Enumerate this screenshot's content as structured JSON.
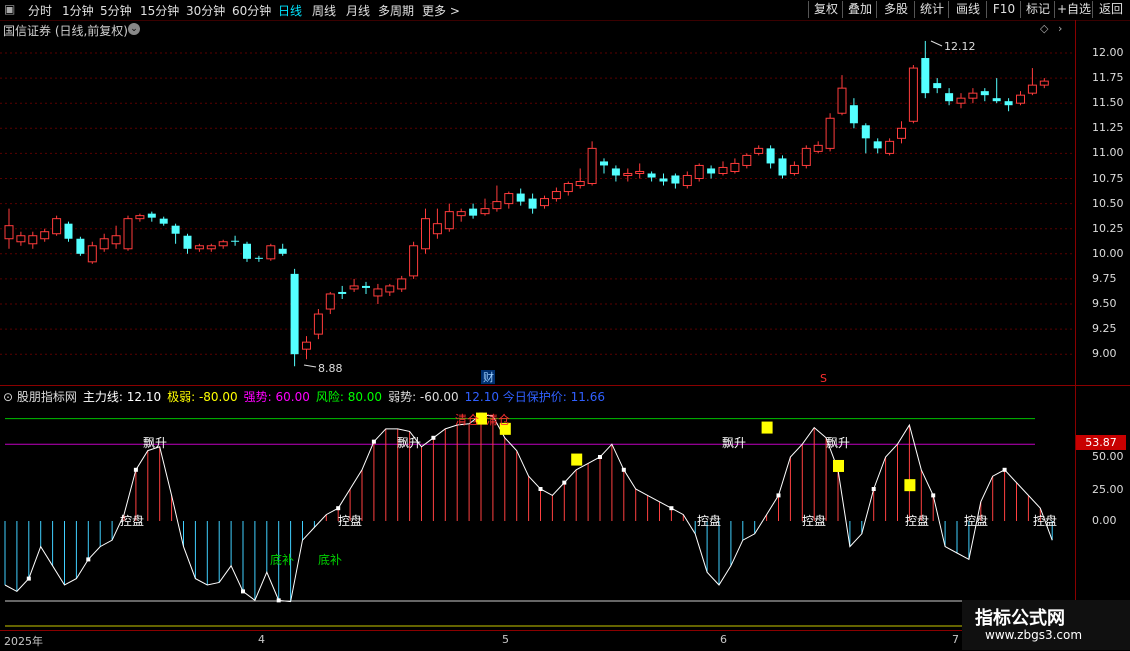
{
  "toolbar": {
    "periods": [
      "分时",
      "1分钟",
      "5分钟",
      "15分钟",
      "30分钟",
      "60分钟",
      "日线",
      "周线",
      "月线",
      "多周期",
      "更多 >"
    ],
    "active_period": "日线",
    "buttons": [
      "复权",
      "叠加",
      "多股",
      "统计",
      "画线",
      "F10",
      "标记",
      "+自选",
      "返回"
    ]
  },
  "stock": {
    "name_line": "国信证券 (日线,前复权)",
    "high_label": "12.12",
    "low_label": "8.88",
    "marker_cai": "财",
    "marker_s": "S"
  },
  "price_axis": [
    "12.00",
    "11.75",
    "11.50",
    "11.25",
    "11.00",
    "10.75",
    "10.50",
    "10.25",
    "10.00",
    "9.75",
    "9.50",
    "9.25",
    "9.00"
  ],
  "indicator": {
    "name": "股朋指标网",
    "items": [
      {
        "label": "主力线:",
        "value": "12.10",
        "color": "#ffffff"
      },
      {
        "label": "极弱:",
        "value": "-80.00",
        "color": "#ffff00"
      },
      {
        "label": "强势:",
        "value": "60.00",
        "color": "#ff00ff"
      },
      {
        "label": "风险:",
        "value": "80.00",
        "color": "#00ff00"
      },
      {
        "label": "弱势:",
        "value": "-60.00",
        "color": "#dddddd"
      },
      {
        "label": "12.10",
        "value": "今日保护价: 11.66",
        "color": "#3060ff"
      }
    ],
    "axis": [
      "50.00",
      "25.00",
      "0.00"
    ],
    "current_value": "53.87",
    "signals": {
      "piao_sheng": "飘升",
      "kong_pan": "控盘",
      "di_bu": "底补",
      "qing_cang": "清仓"
    }
  },
  "dates": [
    "2025年",
    "4",
    "5",
    "6",
    "7"
  ],
  "watermark": {
    "line1": "指标公式网",
    "line2": "www.zbgs3.com"
  },
  "colors": {
    "up": "#ff3c3c",
    "down": "#54ffff",
    "background": "#000000",
    "grid": "#8a0000"
  }
}
